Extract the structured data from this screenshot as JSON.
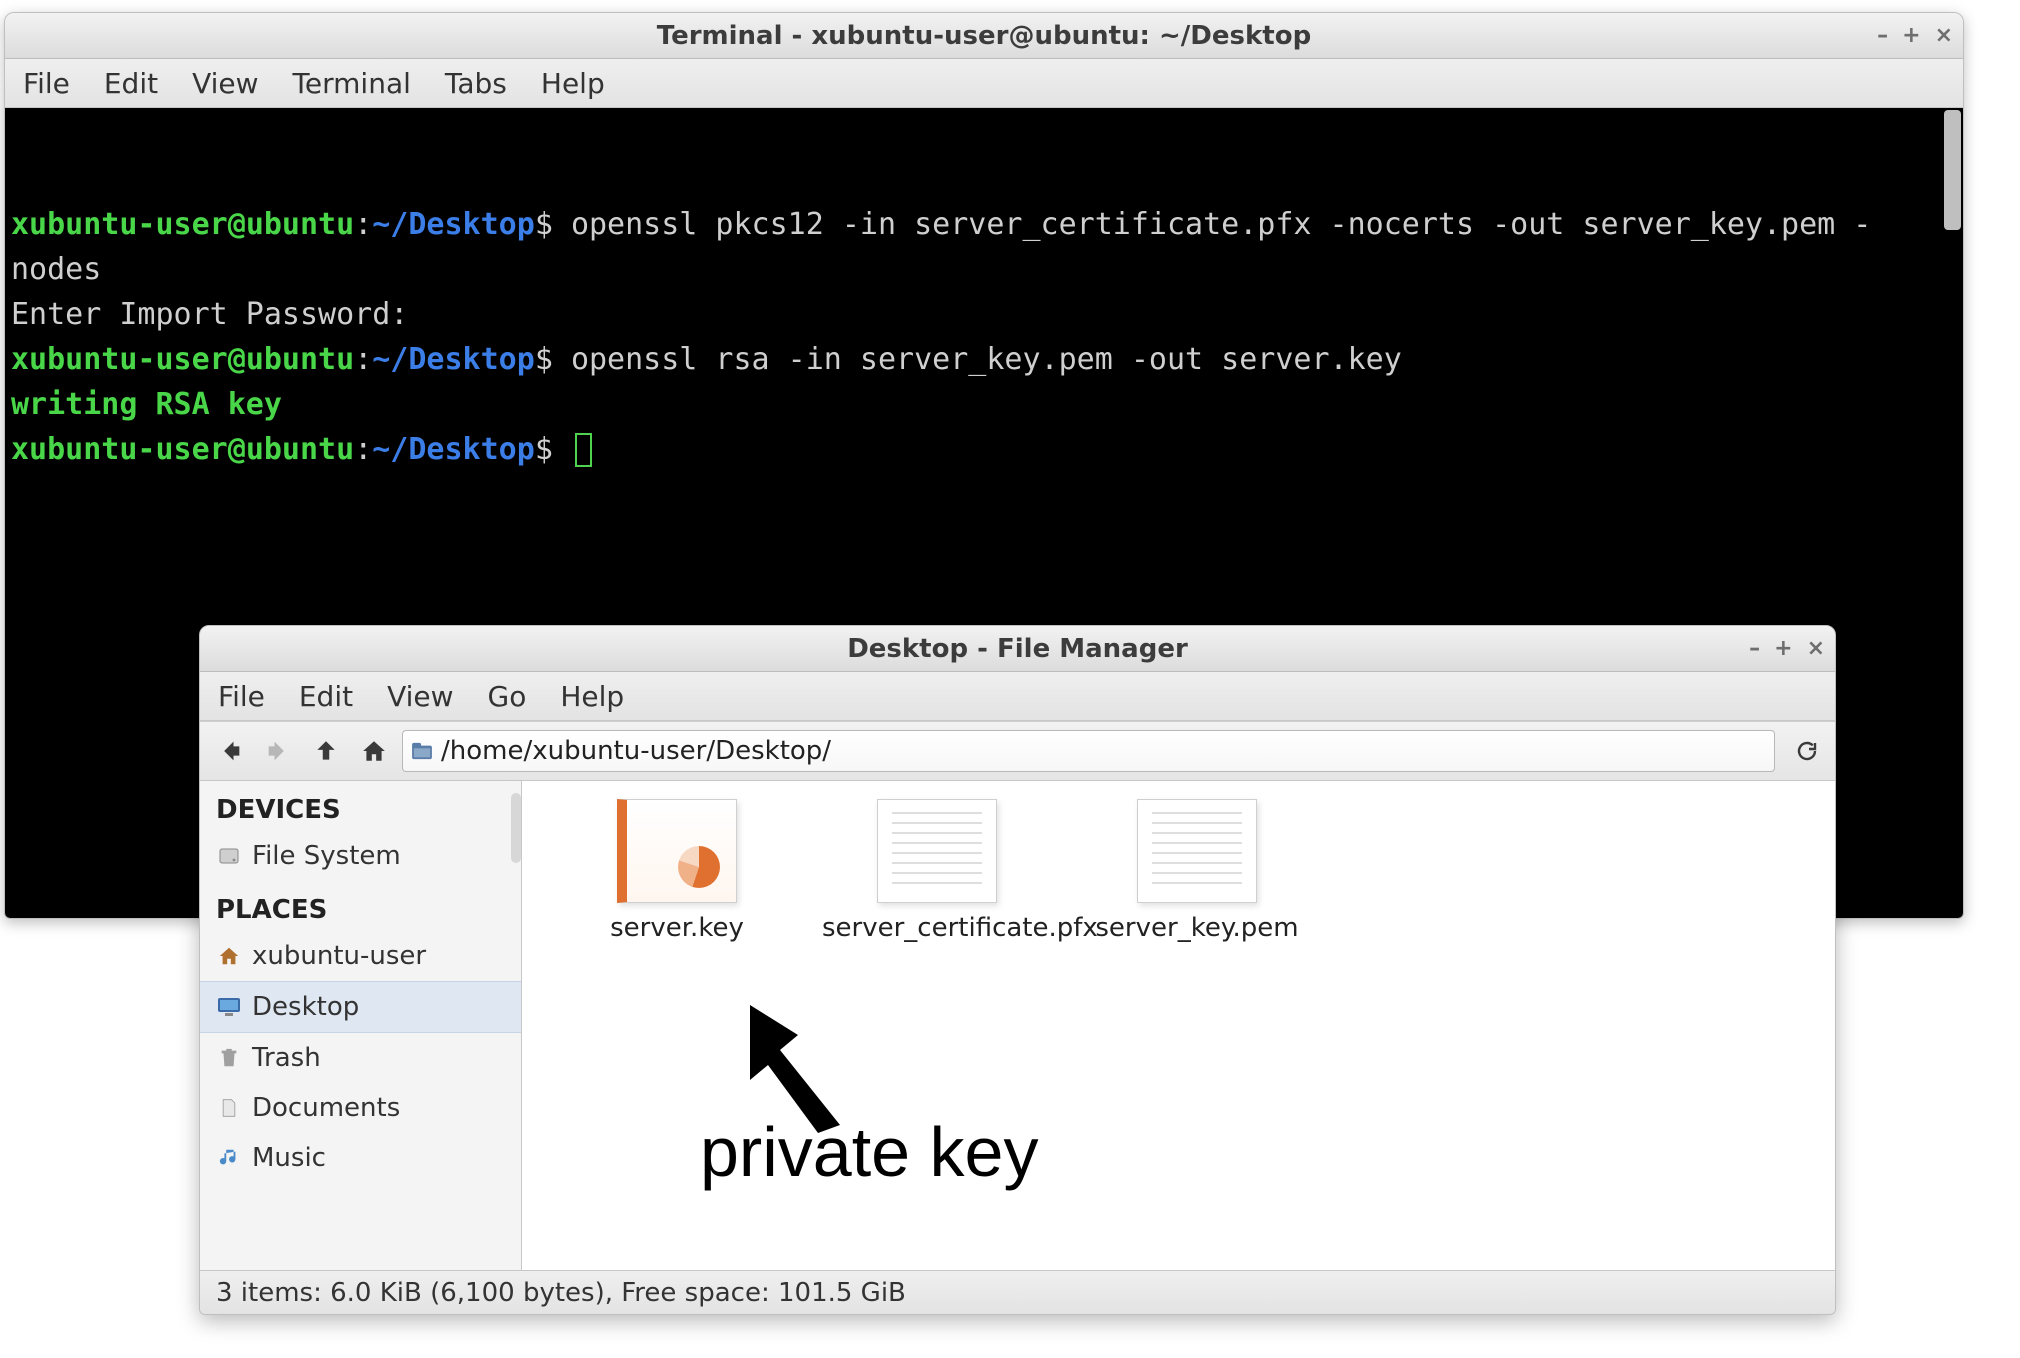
{
  "terminal": {
    "title": "Terminal - xubuntu-user@ubuntu: ~/Desktop",
    "menu": [
      "File",
      "Edit",
      "View",
      "Terminal",
      "Tabs",
      "Help"
    ],
    "prompt": {
      "user": "xubuntu-user",
      "at": "@",
      "host": "ubuntu",
      "colon": ":",
      "path": "~/Desktop",
      "dollar": "$"
    },
    "line1_cmd": "openssl pkcs12 -in server_certificate.pfx -nocerts -out server_key.pem -nodes",
    "line2_out": "Enter Import Password:",
    "line3_cmd": "openssl rsa -in server_key.pem -out server.key",
    "line4_out": "writing RSA key"
  },
  "window_controls": {
    "minimize": "–",
    "maximize": "+",
    "close": "×"
  },
  "file_manager": {
    "title": "Desktop - File Manager",
    "menu": [
      "File",
      "Edit",
      "View",
      "Go",
      "Help"
    ],
    "path": "/home/xubuntu-user/Desktop/",
    "sidebar": {
      "devices": {
        "heading": "DEVICES",
        "items": [
          {
            "label": "File System",
            "name": "sidebar-item-file-system"
          }
        ]
      },
      "places": {
        "heading": "PLACES",
        "items": [
          {
            "label": "xubuntu-user",
            "name": "sidebar-item-home"
          },
          {
            "label": "Desktop",
            "name": "sidebar-item-desktop",
            "selected": true
          },
          {
            "label": "Trash",
            "name": "sidebar-item-trash"
          },
          {
            "label": "Documents",
            "name": "sidebar-item-documents"
          },
          {
            "label": "Music",
            "name": "sidebar-item-music"
          }
        ]
      }
    },
    "files": [
      {
        "label": "server.key",
        "name": "file-server-key",
        "type": "server"
      },
      {
        "label": "server_certificate.pfx",
        "name": "file-server-certificate-pfx",
        "type": "doc"
      },
      {
        "label": "server_key.pem",
        "name": "file-server-key-pem",
        "type": "doc"
      }
    ],
    "status": "3 items: 6.0 KiB (6,100 bytes), Free space: 101.5 GiB"
  },
  "annotation": {
    "label": "private key"
  }
}
